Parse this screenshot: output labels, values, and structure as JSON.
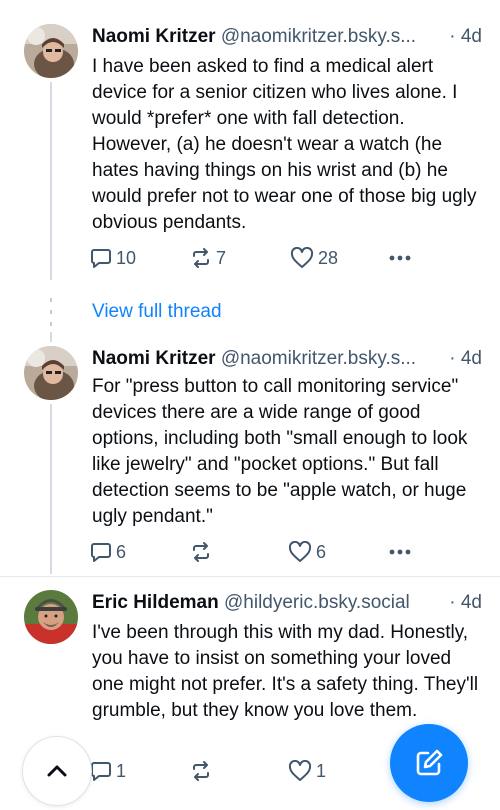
{
  "posts": [
    {
      "author": "Naomi Kritzer",
      "handle": "@naomikritzer.bsky.s...",
      "separator": "·",
      "time": "4d",
      "body": "I have been asked to find a medical alert device for a senior citizen who lives alone. I would *prefer* one with fall detection. However, (a) he doesn't wear a watch (he hates having things on his wrist and (b) he would prefer not to wear one of those big ugly obvious pendants.",
      "replies": "10",
      "reposts": "7",
      "likes": "28"
    },
    {
      "author": "Naomi Kritzer",
      "handle": "@naomikritzer.bsky.s...",
      "separator": "·",
      "time": "4d",
      "body": "For \"press button to call monitoring service\" devices there are a wide range of good options, including both \"small enough to look like jewelry\" and \"pocket options.\" But fall detection seems to be \"apple watch, or huge ugly pendant.\"",
      "replies": "6",
      "reposts": "",
      "likes": "6"
    },
    {
      "author": "Eric Hildeman",
      "handle": "@hildyeric.bsky.social",
      "separator": "·",
      "time": "4d",
      "body": "I've been through this with my dad. Honestly, you have to insist on something your loved one might not prefer. It's a safety thing. They'll grumble, but they know you love them.",
      "replies": "1",
      "reposts": "",
      "likes": "1"
    }
  ],
  "thread": {
    "view_full_thread": "View full thread"
  },
  "icons": {
    "reply": "speech-bubble-icon",
    "repost": "repost-arrows-icon",
    "like": "heart-icon",
    "more": "ellipsis-icon",
    "scroll_top": "chevron-up-icon",
    "compose": "pencil-square-icon"
  },
  "colors": {
    "accent": "#1083fe",
    "muted": "#42576c",
    "text": "#0b0f14"
  }
}
